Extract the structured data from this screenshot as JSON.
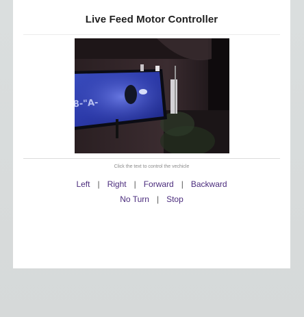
{
  "title": "Live Feed Motor Controller",
  "instruction": "Click the text to control the vechicle",
  "controls": {
    "row1": [
      "Left",
      "Right",
      "Forward",
      "Backward"
    ],
    "row2": [
      "No Turn",
      "Stop"
    ],
    "separator": "|"
  },
  "colors": {
    "link": "#4a2b7c",
    "title": "#202020",
    "page_background": "#d9dcdc",
    "card_background": "#ffffff"
  }
}
